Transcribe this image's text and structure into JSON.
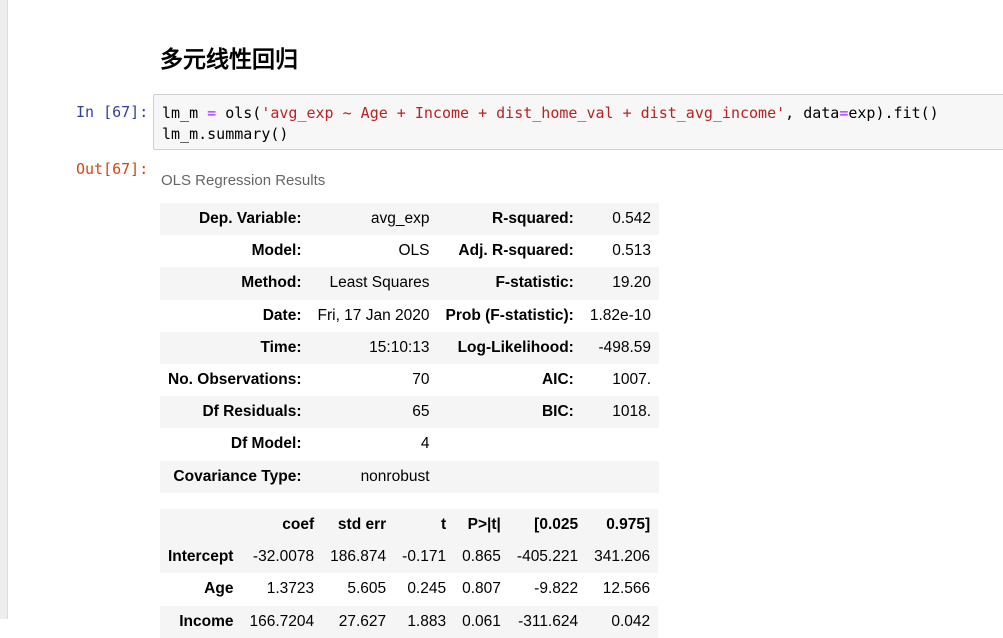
{
  "heading": "多元线性回归",
  "input_cell": {
    "prompt": "In [67]:",
    "code_line1": {
      "pre": "lm_m ",
      "eq1": "=",
      "mid": " ols(",
      "formula": "'avg_exp ~ Age + Income + dist_home_val + dist_avg_income'",
      "mid2": ", data",
      "eq2": "=",
      "post": "exp).fit()"
    },
    "code_line2": "lm_m.summary()"
  },
  "output_cell": {
    "prompt": "Out[67]:",
    "caption": "OLS Regression Results",
    "summary_rows": [
      {
        "label1": "Dep. Variable:",
        "value1": "avg_exp",
        "label2": "R-squared:",
        "value2": "0.542"
      },
      {
        "label1": "Model:",
        "value1": "OLS",
        "label2": "Adj. R-squared:",
        "value2": "0.513"
      },
      {
        "label1": "Method:",
        "value1": "Least Squares",
        "label2": "F-statistic:",
        "value2": "19.20"
      },
      {
        "label1": "Date:",
        "value1": "Fri, 17 Jan 2020",
        "label2": "Prob (F-statistic):",
        "value2": "1.82e-10"
      },
      {
        "label1": "Time:",
        "value1": "15:10:13",
        "label2": "Log-Likelihood:",
        "value2": "-498.59"
      },
      {
        "label1": "No. Observations:",
        "value1": "70",
        "label2": "AIC:",
        "value2": "1007."
      },
      {
        "label1": "Df Residuals:",
        "value1": "65",
        "label2": "BIC:",
        "value2": "1018."
      },
      {
        "label1": "Df Model:",
        "value1": "4",
        "label2": "",
        "value2": ""
      },
      {
        "label1": "Covariance Type:",
        "value1": "nonrobust",
        "label2": "",
        "value2": ""
      }
    ],
    "coef_headers": [
      "",
      "coef",
      "std err",
      "t",
      "P>|t|",
      "[0.025",
      "0.975]"
    ],
    "coef_rows": [
      [
        "Intercept",
        "-32.0078",
        "186.874",
        "-0.171",
        "0.865",
        "-405.221",
        "341.206"
      ],
      [
        "Age",
        "1.3723",
        "5.605",
        "0.245",
        "0.807",
        "-9.822",
        "12.566"
      ],
      [
        "Income",
        "166.7204",
        "27.627",
        "1.883",
        "0.061",
        "-311.624",
        "0.042"
      ]
    ]
  }
}
